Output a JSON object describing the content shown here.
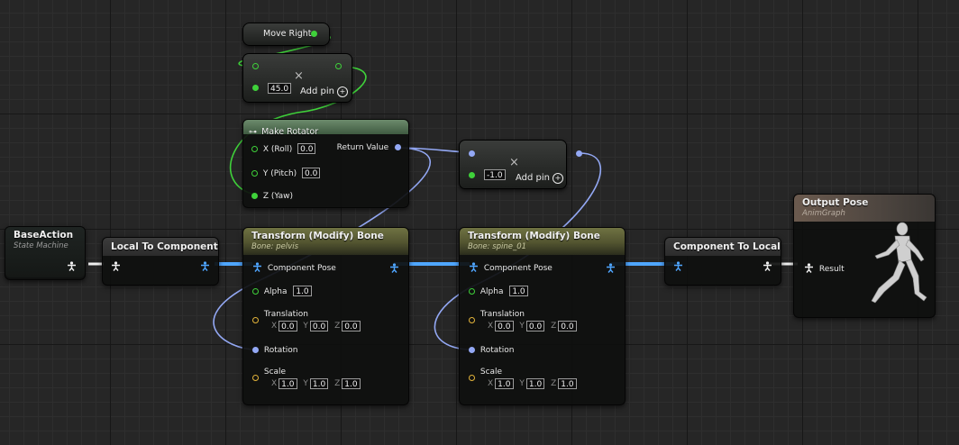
{
  "graph": {
    "base_action": {
      "title": "BaseAction",
      "subtitle": "State Machine"
    },
    "local_to_component": {
      "title": "Local To Component"
    },
    "component_to_local": {
      "title": "Component To Local"
    },
    "output_pose": {
      "title": "Output Pose",
      "subtitle": "AnimGraph",
      "result_label": "Result"
    },
    "move_right": {
      "title": "Move Right"
    },
    "multiply_top": {
      "value": "45.0",
      "add_pin_label": "Add pin",
      "operator": "×"
    },
    "multiply_right": {
      "value": "-1.0",
      "add_pin_label": "Add pin",
      "operator": "×"
    },
    "make_rotator": {
      "title": "Make Rotator",
      "pins": {
        "x_label": "X (Roll)",
        "x_value": "0.0",
        "y_label": "Y (Pitch)",
        "y_value": "0.0",
        "z_label": "Z (Yaw)",
        "return_label": "Return Value"
      }
    },
    "transform_bones": [
      {
        "title": "Transform (Modify) Bone",
        "subtitle": "Bone: pelvis",
        "component_pose_label": "Component Pose",
        "alpha_label": "Alpha",
        "alpha_value": "1.0",
        "translation_label": "Translation",
        "translation": {
          "x": "0.0",
          "y": "0.0",
          "z": "0.0"
        },
        "rotation_label": "Rotation",
        "scale_label": "Scale",
        "scale": {
          "x": "1.0",
          "y": "1.0",
          "z": "1.0"
        }
      },
      {
        "title": "Transform (Modify) Bone",
        "subtitle": "Bone: spine_01",
        "component_pose_label": "Component Pose",
        "alpha_label": "Alpha",
        "alpha_value": "1.0",
        "translation_label": "Translation",
        "translation": {
          "x": "0.0",
          "y": "0.0",
          "z": "0.0"
        },
        "rotation_label": "Rotation",
        "scale_label": "Scale",
        "scale": {
          "x": "1.0",
          "y": "1.0",
          "z": "1.0"
        }
      }
    ],
    "axis_labels": {
      "x": "X",
      "y": "Y",
      "z": "Z"
    }
  },
  "colors": {
    "float_pin": "#3fd13a",
    "struct_pin": "#93a8f4",
    "vector_pin": "#e3b43a",
    "pose_wire": "#4fa6ff",
    "grid_bg": "#262626"
  },
  "icons": [
    "pose-pin-icon",
    "float-pin-icon",
    "rotator-pin-icon",
    "vector-pin-icon",
    "make-struct-icon",
    "multiply-icon",
    "add-pin-icon",
    "mannequin-icon"
  ]
}
